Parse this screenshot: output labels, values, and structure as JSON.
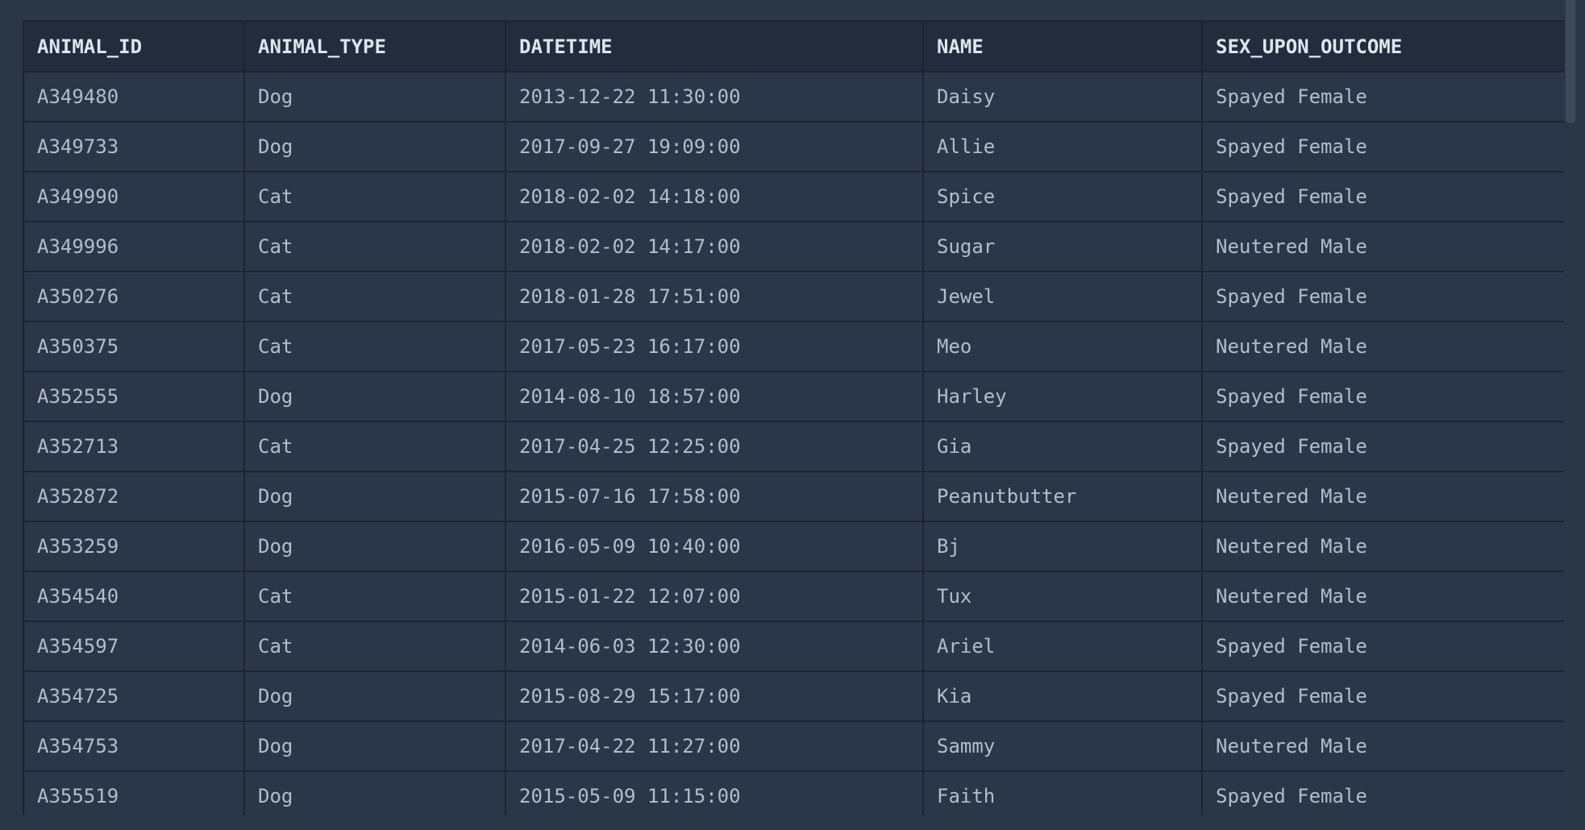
{
  "table": {
    "columns": [
      "ANIMAL_ID",
      "ANIMAL_TYPE",
      "DATETIME",
      "NAME",
      "SEX_UPON_OUTCOME"
    ],
    "rows": [
      [
        "A349480",
        "Dog",
        "2013-12-22 11:30:00",
        "Daisy",
        "Spayed Female"
      ],
      [
        "A349733",
        "Dog",
        "2017-09-27 19:09:00",
        "Allie",
        "Spayed Female"
      ],
      [
        "A349990",
        "Cat",
        "2018-02-02 14:18:00",
        "Spice",
        "Spayed Female"
      ],
      [
        "A349996",
        "Cat",
        "2018-02-02 14:17:00",
        "Sugar",
        "Neutered Male"
      ],
      [
        "A350276",
        "Cat",
        "2018-01-28 17:51:00",
        "Jewel",
        "Spayed Female"
      ],
      [
        "A350375",
        "Cat",
        "2017-05-23 16:17:00",
        "Meo",
        "Neutered Male"
      ],
      [
        "A352555",
        "Dog",
        "2014-08-10 18:57:00",
        "Harley",
        "Spayed Female"
      ],
      [
        "A352713",
        "Cat",
        "2017-04-25 12:25:00",
        "Gia",
        "Spayed Female"
      ],
      [
        "A352872",
        "Dog",
        "2015-07-16 17:58:00",
        "Peanutbutter",
        "Neutered Male"
      ],
      [
        "A353259",
        "Dog",
        "2016-05-09 10:40:00",
        "Bj",
        "Neutered Male"
      ],
      [
        "A354540",
        "Cat",
        "2015-01-22 12:07:00",
        "Tux",
        "Neutered Male"
      ],
      [
        "A354597",
        "Cat",
        "2014-06-03 12:30:00",
        "Ariel",
        "Spayed Female"
      ],
      [
        "A354725",
        "Dog",
        "2015-08-29 15:17:00",
        "Kia",
        "Spayed Female"
      ],
      [
        "A354753",
        "Dog",
        "2017-04-22 11:27:00",
        "Sammy",
        "Neutered Male"
      ],
      [
        "A355519",
        "Dog",
        "2015-05-09 11:15:00",
        "Faith",
        "Spayed Female"
      ]
    ]
  },
  "colors": {
    "background": "#2b3747",
    "header_bg": "#222c3c",
    "header_text": "#dfe5ee",
    "cell_text": "#b3bdca",
    "grid": "#1b2432"
  }
}
